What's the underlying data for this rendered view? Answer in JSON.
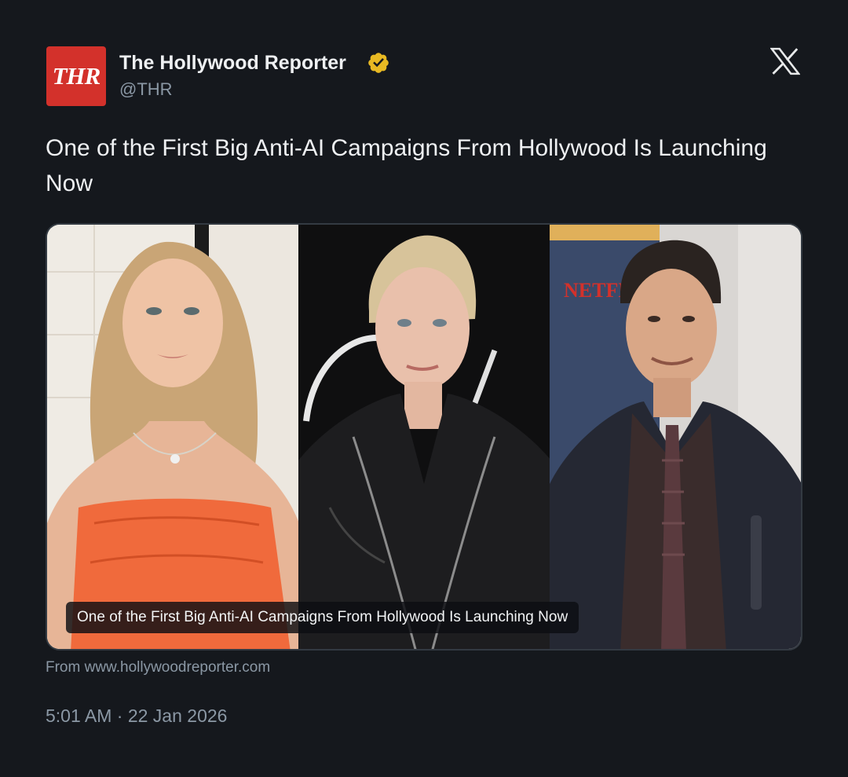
{
  "account": {
    "avatar_text": "THR",
    "display_name": "The Hollywood Reporter",
    "handle": "@THR",
    "verified_icon": "gold-verified-badge",
    "brand_color": "#d3312b",
    "verified_color": "#e8b923"
  },
  "platform": {
    "logo_icon": "x-logo-icon"
  },
  "tweet": {
    "text": "One of the First Big Anti-AI Campaigns From Hollywood Is Launching Now"
  },
  "link_card": {
    "caption": "One of the First Big Anti-AI Campaigns From Hollywood Is Launching Now",
    "source": "From www.hollywoodreporter.com",
    "images": [
      {
        "name": "photo-woman-orange-dress"
      },
      {
        "name": "photo-woman-leather-jacket"
      },
      {
        "name": "photo-man-dark-suit"
      }
    ],
    "backdrop_text": "NETFLIX"
  },
  "meta": {
    "timestamp": "5:01 AM · 22 Jan 2026"
  }
}
